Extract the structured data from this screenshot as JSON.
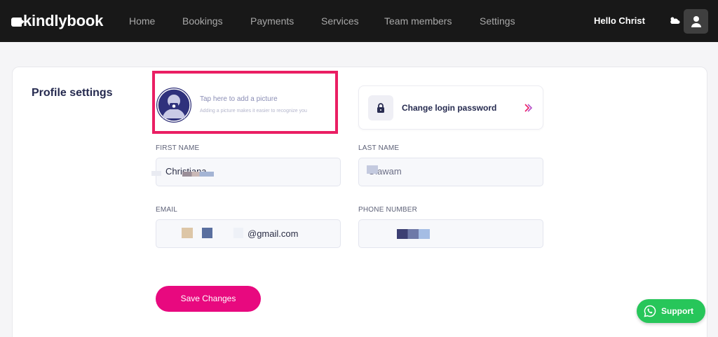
{
  "brand": {
    "name": "kindlybook"
  },
  "nav": {
    "items": [
      {
        "label": "Home"
      },
      {
        "label": "Bookings"
      },
      {
        "label": "Payments"
      },
      {
        "label": "Services"
      },
      {
        "label": "Team members"
      },
      {
        "label": "Settings"
      }
    ],
    "greeting": "Hello Christ",
    "icons": {
      "weather": "cloud-sun-icon",
      "user": "user-icon"
    }
  },
  "profile": {
    "title": "Profile settings",
    "picture": {
      "title": "Tap here to add a picture",
      "subtitle": "Adding a picture makes it easier to recognize you"
    },
    "password": {
      "label": "Change login password",
      "icon": "lock-icon",
      "arrow": "chevron-right-icon"
    },
    "fields": {
      "first_name": {
        "label": "FIRST NAME",
        "value": "Christiana"
      },
      "last_name": {
        "label": "LAST NAME",
        "value": "Olawam"
      },
      "email": {
        "label": "EMAIL",
        "value": "@gmail.com"
      },
      "phone": {
        "label": "PHONE NUMBER",
        "value": ""
      }
    },
    "save_label": "Save Changes"
  },
  "support": {
    "label": "Support",
    "icon": "whatsapp-icon"
  },
  "colors": {
    "topbar": "#181818",
    "accent": "#e8097f",
    "highlight_border": "#ea1e63",
    "support": "#27c65a",
    "heading": "#252a4f"
  }
}
